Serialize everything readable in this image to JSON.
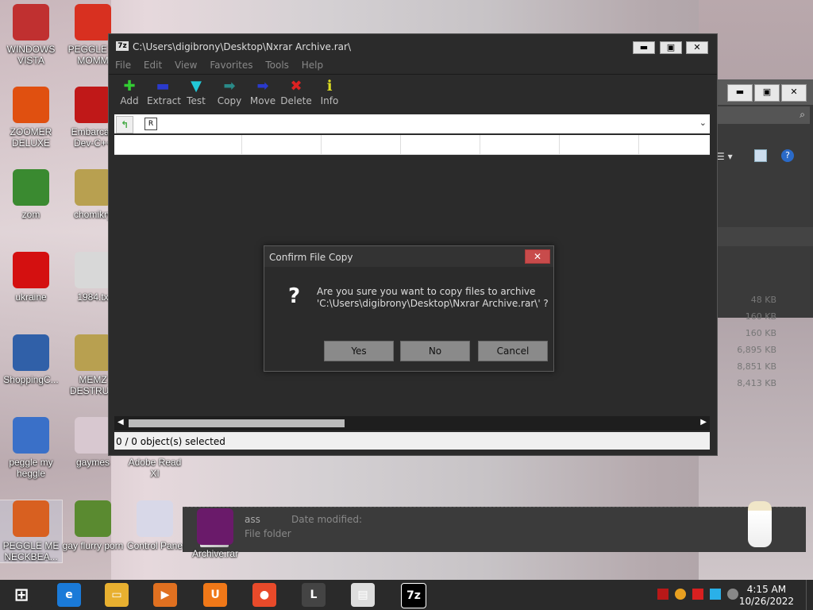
{
  "desktop_icons": [
    {
      "label": "WINDOWS VISTA",
      "color": "#c03030"
    },
    {
      "label": "PEGGLE M MOMM",
      "color": "#d83020"
    },
    {
      "label": "ZOOMER DELUXE",
      "color": "#e05010"
    },
    {
      "label": "Embarcad Dev-C++",
      "color": "#c01818"
    },
    {
      "label": "zom",
      "color": "#3a8a30"
    },
    {
      "label": "chomikry",
      "color": "#b8a050"
    },
    {
      "label": "ukraine",
      "color": "#d41010"
    },
    {
      "label": "1984.tx",
      "color": "#d8d8d8"
    },
    {
      "label": "ShoppingC...",
      "color": "#3060a8"
    },
    {
      "label": "MEMZ DESTRUC",
      "color": "#b8a050"
    },
    {
      "label": "peggle my heggle",
      "color": "#3a70c8"
    },
    {
      "label": "gaymes",
      "color": "#d8c8d0"
    },
    {
      "label": "Adobe Read XI",
      "color": "#c81818"
    },
    {
      "label": "PEGGLE ME NECKBEA...",
      "color": "#d86020"
    },
    {
      "label": "gay flurry porn",
      "color": "#5a8a30"
    },
    {
      "label": "Control Pane",
      "color": "#d8d8e8"
    },
    {
      "label": "Archive.rar",
      "color": "#6a1a6a"
    }
  ],
  "winrar": {
    "logo": "7z",
    "title": "C:\\Users\\digibrony\\Desktop\\Nxrar Archive.rar\\",
    "win_min": "▬",
    "win_max": "▣",
    "win_close": "✕",
    "menu": [
      "File",
      "Edit",
      "View",
      "Favorites",
      "Tools",
      "Help"
    ],
    "tools": [
      {
        "label": "Add",
        "glyph": "✚",
        "color": "#33cc33"
      },
      {
        "label": "Extract",
        "glyph": "▬",
        "color": "#2a3acc"
      },
      {
        "label": "Test",
        "glyph": "▼",
        "color": "#22c8d8"
      },
      {
        "label": "Copy",
        "glyph": "➡",
        "color": "#2a8a88"
      },
      {
        "label": "Move",
        "glyph": "➡",
        "color": "#2a3acc"
      },
      {
        "label": "Delete",
        "glyph": "✖",
        "color": "#dd2222"
      },
      {
        "label": "Info",
        "glyph": "ℹ",
        "color": "#dddd22"
      }
    ],
    "address_icon": "R",
    "status": "0 / 0 object(s) selected"
  },
  "dialog": {
    "title": "Confirm File Copy",
    "close": "✕",
    "icon": "?",
    "message_line1": "Are you sure you want to copy files to archive",
    "message_line2": "'C:\\Users\\digibrony\\Desktop\\Nxrar Archive.rar\\' ?",
    "yes": "Yes",
    "no": "No",
    "cancel": "Cancel"
  },
  "explorer_bg": {
    "sizes": [
      "48 KB",
      "160 KB",
      "160 KB",
      "6,895 KB",
      "8,851 KB",
      "8,413 KB"
    ],
    "folder_name": "ass",
    "folder_type": "File folder",
    "date_modified": "Date modified:"
  },
  "taskbar": {
    "items": [
      {
        "name": "start",
        "glyph": "⊞",
        "color": "#2a2a2a"
      },
      {
        "name": "ie",
        "glyph": "e",
        "color": "#1a7ad8"
      },
      {
        "name": "explorer",
        "glyph": "▭",
        "color": "#e8b030"
      },
      {
        "name": "media",
        "glyph": "▶",
        "color": "#e07020"
      },
      {
        "name": "uc",
        "glyph": "U",
        "color": "#f07818"
      },
      {
        "name": "chrome",
        "glyph": "●",
        "color": "#e84a2a"
      },
      {
        "name": "app",
        "glyph": "L",
        "color": "#444"
      },
      {
        "name": "notepad",
        "glyph": "▤",
        "color": "#dddddd"
      },
      {
        "name": "7z",
        "glyph": "7z",
        "color": "#000000"
      }
    ],
    "time": "4:15 AM",
    "date": "10/26/2022"
  }
}
